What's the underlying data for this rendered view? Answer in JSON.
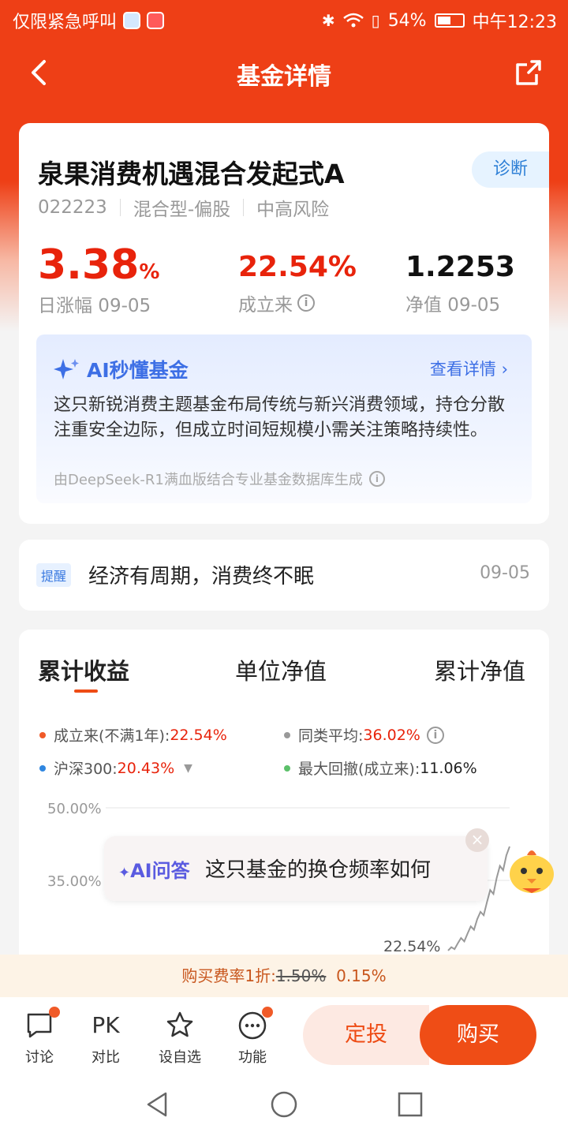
{
  "status_bar": {
    "carrier_text": "仅限紧急呼叫",
    "battery_pct": "54%",
    "battery_level": 0.54,
    "time": "中午12:23"
  },
  "nav": {
    "title": "基金详情"
  },
  "fund": {
    "name": "泉果消费机遇混合发起式A",
    "diagnose_label": "诊断",
    "code": "022223",
    "type": "混合型-偏股",
    "risk": "中高风险",
    "daily_change_value": "3.38",
    "daily_change_unit": "%",
    "daily_change_label": "日涨幅 09-05",
    "since_inception_value": "22.54%",
    "since_inception_label": "成立来",
    "nav_value": "1.2253",
    "nav_label": "净值 09-05"
  },
  "ai_summary": {
    "title": "AI秒懂基金",
    "more_label": "查看详情",
    "text": "这只新锐消费主题基金布局传统与新兴消费领域，持仓分散注重安全边际，但成立时间短规模小需关注策略持续性。",
    "footnote": "由DeepSeek-R1满血版结合专业基金数据库生成"
  },
  "reminder": {
    "tag": "提醒",
    "text": "经济有周期，消费终不眠",
    "date": "09-05"
  },
  "chart_tabs": {
    "tab1": "累计收益",
    "tab2": "单位净值",
    "tab3": "累计净值"
  },
  "legend": {
    "item1_label": "成立来(不满1年):",
    "item1_value": "22.54%",
    "item2_label": "同类平均:",
    "item2_value": "36.02%",
    "item3_label": "沪深300:",
    "item3_value": "20.43%",
    "item4_label": "最大回撤(成立来):",
    "item4_value": "11.06%"
  },
  "chart_data": {
    "type": "line",
    "yticks": [
      "50.00%",
      "35.00%"
    ],
    "ylim": [
      20,
      50
    ],
    "end_label": "22.54%",
    "series": [
      {
        "name": "同类平均",
        "color": "#999999",
        "values": [
          20.5,
          21.2,
          20.8,
          22.0,
          23.1,
          22.4,
          24.0,
          25.5,
          24.8,
          27.0,
          28.5,
          27.8,
          30.5,
          33.0,
          32.2,
          35.5,
          38.0,
          37.1,
          40.2,
          42.0
        ]
      }
    ]
  },
  "ai_qa": {
    "label": "AI问答",
    "question": "这只基金的换仓频率如何",
    "close": "×"
  },
  "fee": {
    "prefix": "购买费率1折:",
    "old_rate": "1.50%",
    "new_rate": "0.15%"
  },
  "bottom_bar": {
    "discuss": "讨论",
    "compare_icon_text": "PK",
    "compare": "对比",
    "watchlist": "设自选",
    "functions": "功能",
    "sip_button": "定投",
    "buy_button": "购买"
  },
  "colors": {
    "brand": "#ee3f16",
    "up_red": "#e8230b",
    "ai_blue": "#3d6fe5"
  }
}
